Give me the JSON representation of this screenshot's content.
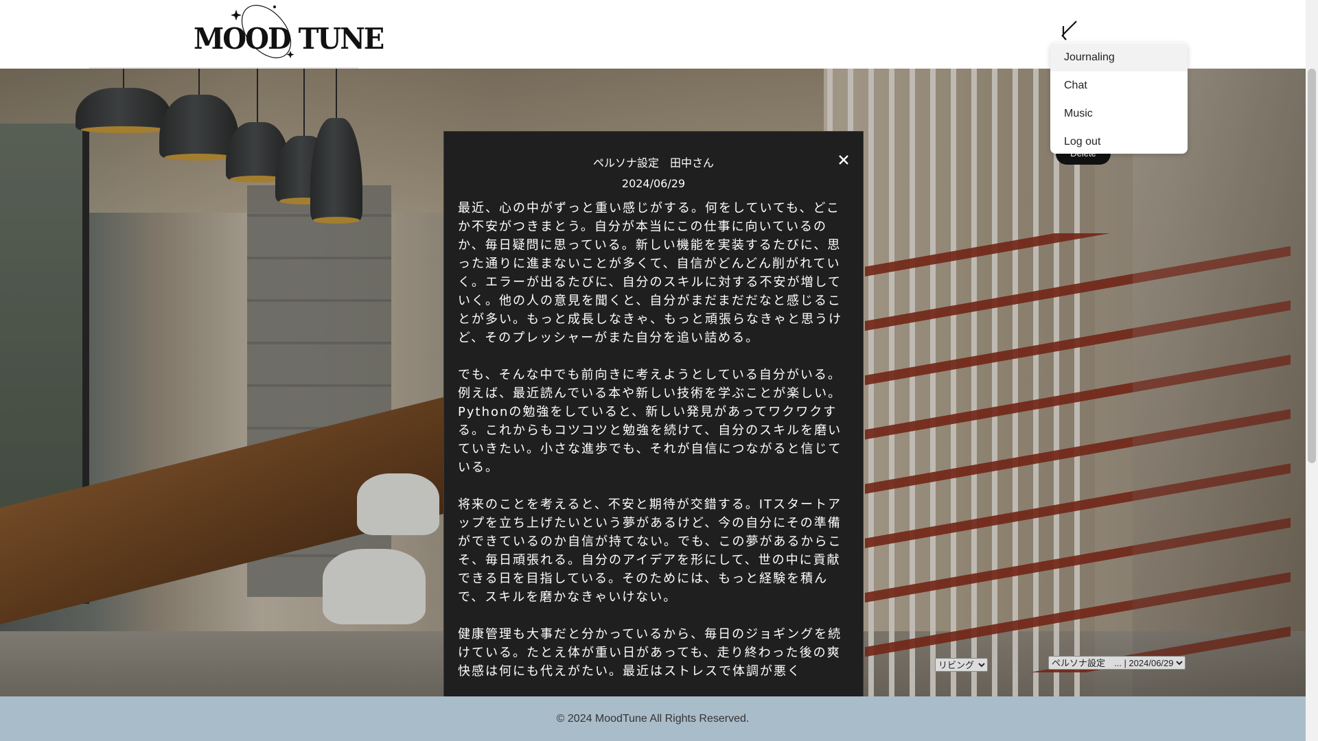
{
  "brand": {
    "logo_text": "MOOD TUNE"
  },
  "nav_menu": {
    "items": [
      {
        "label": "Journaling",
        "active": true
      },
      {
        "label": "Chat",
        "active": false
      },
      {
        "label": "Music",
        "active": false
      },
      {
        "label": "Log out",
        "active": false
      }
    ]
  },
  "controls": {
    "delete_label": "Delete",
    "room_select": {
      "selected": "リビング"
    },
    "persona_select": {
      "selected": "ペルソナ設定　... | 2024/06/29"
    }
  },
  "modal": {
    "title": "ペルソナ設定　田中さん",
    "date": "2024/06/29",
    "paragraphs": [
      "最近、心の中がずっと重い感じがする。何をしていても、どこか不安がつきまとう。自分が本当にこの仕事に向いているのか、毎日疑問に思っている。新しい機能を実装するたびに、思った通りに進まないことが多くて、自信がどんどん削がれていく。エラーが出るたびに、自分のスキルに対する不安が増していく。他の人の意見を聞くと、自分がまだまだだなと感じることが多い。もっと成長しなきゃ、もっと頑張らなきゃと思うけど、そのプレッシャーがまた自分を追い詰める。",
      "でも、そんな中でも前向きに考えようとしている自分がいる。例えば、最近読んでいる本や新しい技術を学ぶことが楽しい。Pythonの勉強をしていると、新しい発見があってワクワクする。これからもコツコツと勉強を続けて、自分のスキルを磨いていきたい。小さな進歩でも、それが自信につながると信じている。",
      "将来のことを考えると、不安と期待が交錯する。ITスタートアップを立ち上げたいという夢があるけど、今の自分にその準備ができているのか自信が持てない。でも、この夢があるからこそ、毎日頑張れる。自分のアイデアを形にして、世の中に貢献できる日を目指している。そのためには、もっと経験を積んで、スキルを磨かなきゃいけない。",
      "健康管理も大事だと分かっているから、毎日のジョギングを続けている。たとえ体が重い日があっても、走り終わった後の爽快感は何にも代えがたい。最近はストレスで体調が悪く"
    ]
  },
  "footer": {
    "copyright": "© 2024 MoodTune All Rights Reserved."
  },
  "icons": {
    "menu_close": "close-menu-icon",
    "modal_close": "close-icon",
    "logo_sparkles": "sparkle-icon"
  },
  "colors": {
    "modal_bg": "#1f1f1f",
    "footer_bg": "#a9bcc9",
    "delete_bg": "#111111"
  }
}
